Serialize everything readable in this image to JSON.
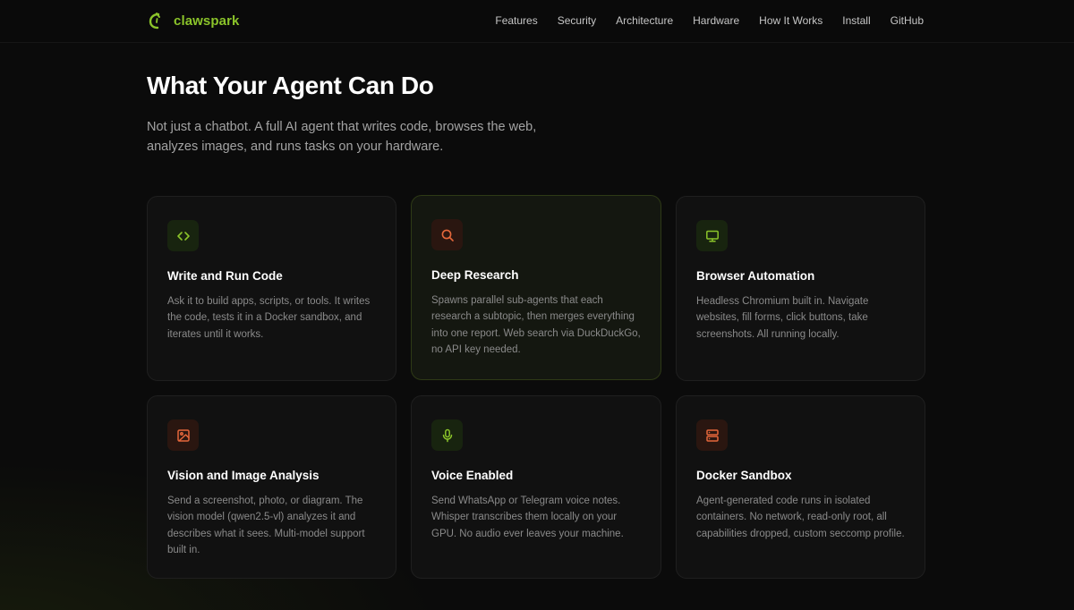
{
  "brand": {
    "name": "clawspark",
    "accent": "#8bc42a",
    "secondary": "#e4673b"
  },
  "nav": {
    "links": [
      "Features",
      "Security",
      "Architecture",
      "Hardware",
      "How It Works",
      "Install",
      "GitHub"
    ]
  },
  "hero": {
    "title": "What Your Agent Can Do",
    "subtitle": "Not just a chatbot. A full AI agent that writes code, browses the web, analyzes images, and runs tasks on your hardware."
  },
  "features": [
    {
      "icon": "code-icon",
      "tone": "green",
      "title": "Write and Run Code",
      "desc": "Ask it to build apps, scripts, or tools. It writes the code, tests it in a Docker sandbox, and iterates until it works."
    },
    {
      "icon": "search-icon",
      "tone": "orange",
      "title": "Deep Research",
      "desc": "Spawns parallel sub-agents that each research a subtopic, then merges everything into one report. Web search via DuckDuckGo, no API key needed."
    },
    {
      "icon": "monitor-icon",
      "tone": "green",
      "title": "Browser Automation",
      "desc": "Headless Chromium built in. Navigate websites, fill forms, click buttons, take screenshots. All running locally."
    },
    {
      "icon": "image-icon",
      "tone": "orange",
      "title": "Vision and Image Analysis",
      "desc": "Send a screenshot, photo, or diagram. The vision model (qwen2.5-vl) analyzes it and describes what it sees. Multi-model support built in."
    },
    {
      "icon": "microphone-icon",
      "tone": "green",
      "title": "Voice Enabled",
      "desc": "Send WhatsApp or Telegram voice notes. Whisper transcribes them locally on your GPU. No audio ever leaves your machine."
    },
    {
      "icon": "server-icon",
      "tone": "orange",
      "title": "Docker Sandbox",
      "desc": "Agent-generated code runs in isolated containers. No network, read-only root, all capabilities dropped, custom seccomp profile."
    }
  ]
}
